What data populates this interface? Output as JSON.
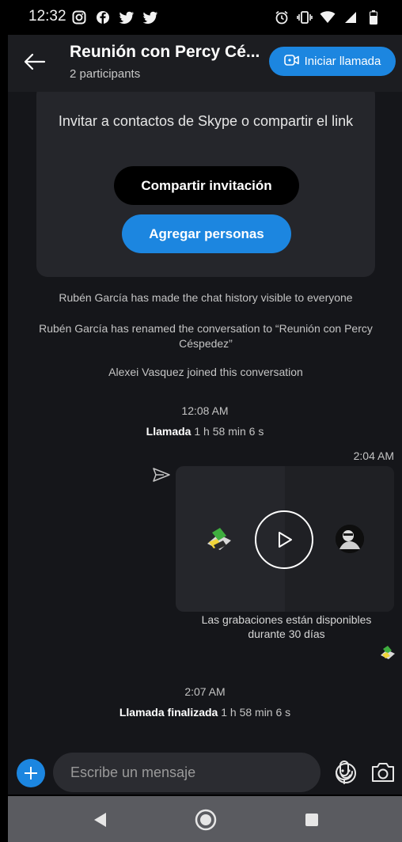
{
  "status_bar": {
    "time": "12:32",
    "left_icons": [
      "instagram-icon",
      "facebook-icon",
      "twitter-icon",
      "twitter-icon"
    ],
    "right_icons": [
      "alarm-icon",
      "vibrate-icon",
      "wifi-icon",
      "signal-icon",
      "battery-icon"
    ]
  },
  "header": {
    "title": "Reunión con Percy Cé...",
    "subtitle": "2 participants",
    "call_button_label": "Iniciar llamada"
  },
  "invite_card": {
    "text": "Invitar a contactos de Skype o compartir el link",
    "share_button_label": "Compartir invitación",
    "add_button_label": "Agregar personas"
  },
  "messages": {
    "sys1": "Rubén García has made the chat history visible to everyone",
    "sys2": "Rubén García has renamed the conversation to “Reunión con Percy Céspedez”",
    "sys3": "Alexei Vasquez joined this conversation",
    "call1_time": "12:08 AM",
    "call1_label": "Llamada",
    "call1_duration": "1 h 58 min 6 s",
    "recording_time": "2:04 AM",
    "recording_caption": "Las grabaciones están disponibles durante 30 días",
    "call2_time": "2:07 AM",
    "call2_label": "Llamada finalizada",
    "call2_duration": "1 h 58 min 6 s"
  },
  "composer": {
    "placeholder": "Escribe un mensaje"
  },
  "colors": {
    "accent": "#1c86e0",
    "background": "#15161a",
    "card": "#25262b"
  }
}
